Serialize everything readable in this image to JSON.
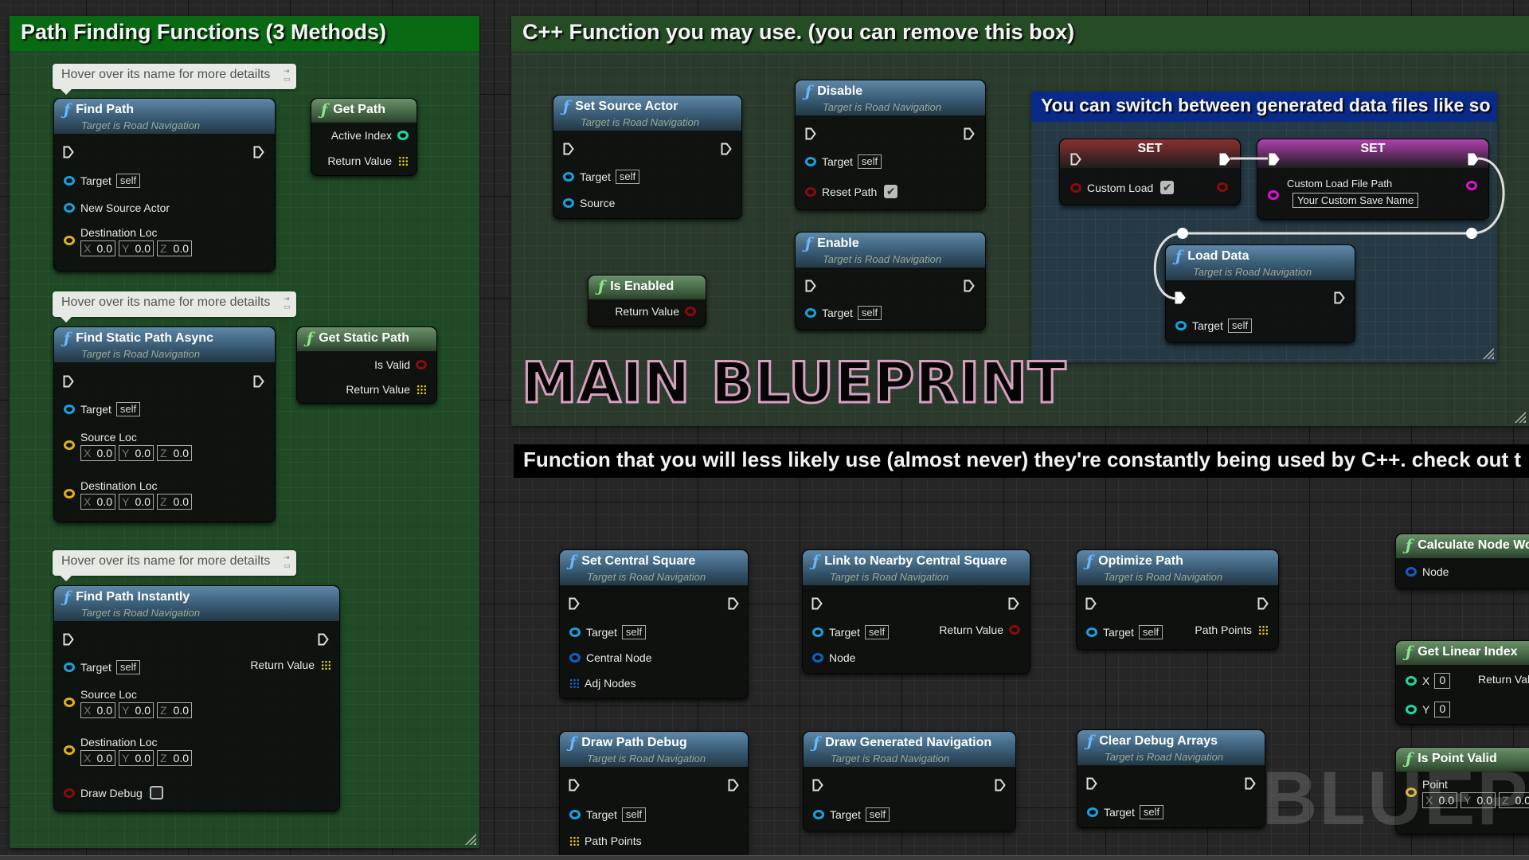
{
  "comments": {
    "left_title": "Path Finding Functions (3 Methods)",
    "cpp_title": "C++ Function you may use. (you can remove this box)",
    "blue_title": "You can switch between generated data files like so"
  },
  "main_title": "MAIN BLUEPRINT",
  "banner": "Function that you will less likely use (almost never) they're constantly being used by C++. check out t",
  "watermark": "BLUEPRI",
  "note_text": "Hover over its name for more detailts",
  "common": {
    "target_sub": "Target is Road Navigation",
    "target": "Target",
    "self": "self",
    "return_value": "Return Value",
    "x": "X",
    "y": "Y",
    "z": "Z",
    "zero": "0.0",
    "int_zero": "0"
  },
  "nodes": {
    "find_path": {
      "title": "Find Path",
      "pins": {
        "new_source_actor": "New Source Actor",
        "destination_loc": "Destination Loc"
      }
    },
    "get_path": {
      "title": "Get Path",
      "pins": {
        "active_index": "Active Index",
        "return_value": "Return Value"
      }
    },
    "find_static_path_async": {
      "title": "Find Static Path Async",
      "pins": {
        "source_loc": "Source Loc",
        "destination_loc": "Destination Loc"
      }
    },
    "get_static_path": {
      "title": "Get Static Path",
      "pins": {
        "is_valid": "Is Valid",
        "return_value": "Return Value"
      }
    },
    "find_path_instantly": {
      "title": "Find Path Instantly",
      "pins": {
        "source_loc": "Source Loc",
        "destination_loc": "Destination Loc",
        "draw_debug": "Draw Debug"
      },
      "draw_debug_checked": false
    },
    "set_source_actor": {
      "title": "Set Source Actor",
      "pins": {
        "source": "Source"
      }
    },
    "is_enabled": {
      "title": "Is Enabled",
      "pins": {
        "return_value": "Return Value"
      }
    },
    "disable": {
      "title": "Disable",
      "pins": {
        "reset_path": "Reset Path"
      },
      "reset_path_checked": true
    },
    "enable": {
      "title": "Enable"
    },
    "set_custom_load": {
      "title": "SET",
      "pins": {
        "custom_load": "Custom Load"
      },
      "custom_load_checked": true
    },
    "set_custom_load_path": {
      "title": "SET",
      "pins": {
        "custom_load_file_path": "Custom Load File Path"
      },
      "value": "Your Custom Save Name"
    },
    "load_data": {
      "title": "Load Data"
    },
    "set_central_square": {
      "title": "Set Central Square",
      "pins": {
        "central_node": "Central Node",
        "adj_nodes": "Adj Nodes"
      }
    },
    "link_to_nearby_central_square": {
      "title": "Link to Nearby Central Square",
      "pins": {
        "node": "Node",
        "return_value": "Return Value"
      }
    },
    "optimize_path": {
      "title": "Optimize Path",
      "pins": {
        "path_points": "Path Points"
      }
    },
    "calculate_node_world": {
      "title": "Calculate Node Wo",
      "pins": {
        "node": "Node"
      }
    },
    "get_linear_index": {
      "title": "Get Linear Index",
      "pins": {
        "x": "X",
        "y": "Y",
        "return_value": "Return Val"
      }
    },
    "is_point_valid": {
      "title": "Is Point Valid",
      "pins": {
        "point": "Point"
      }
    },
    "draw_path_debug": {
      "title": "Draw Path Debug",
      "pins": {
        "path_points": "Path Points"
      }
    },
    "draw_generated_navigation": {
      "title": "Draw Generated Navigation"
    },
    "clear_debug_arrays": {
      "title": "Clear Debug Arrays"
    }
  },
  "colors": {
    "left_comment": "#0a6a14",
    "cpp_comment": "#264c26",
    "blue_comment": "#0a2a8a",
    "pin_object": "#19a0e0",
    "pin_vector": "#e0b020",
    "pin_bool": "#8c0a0a",
    "pin_int": "#1ed8a0",
    "pin_string": "#e010d0"
  }
}
